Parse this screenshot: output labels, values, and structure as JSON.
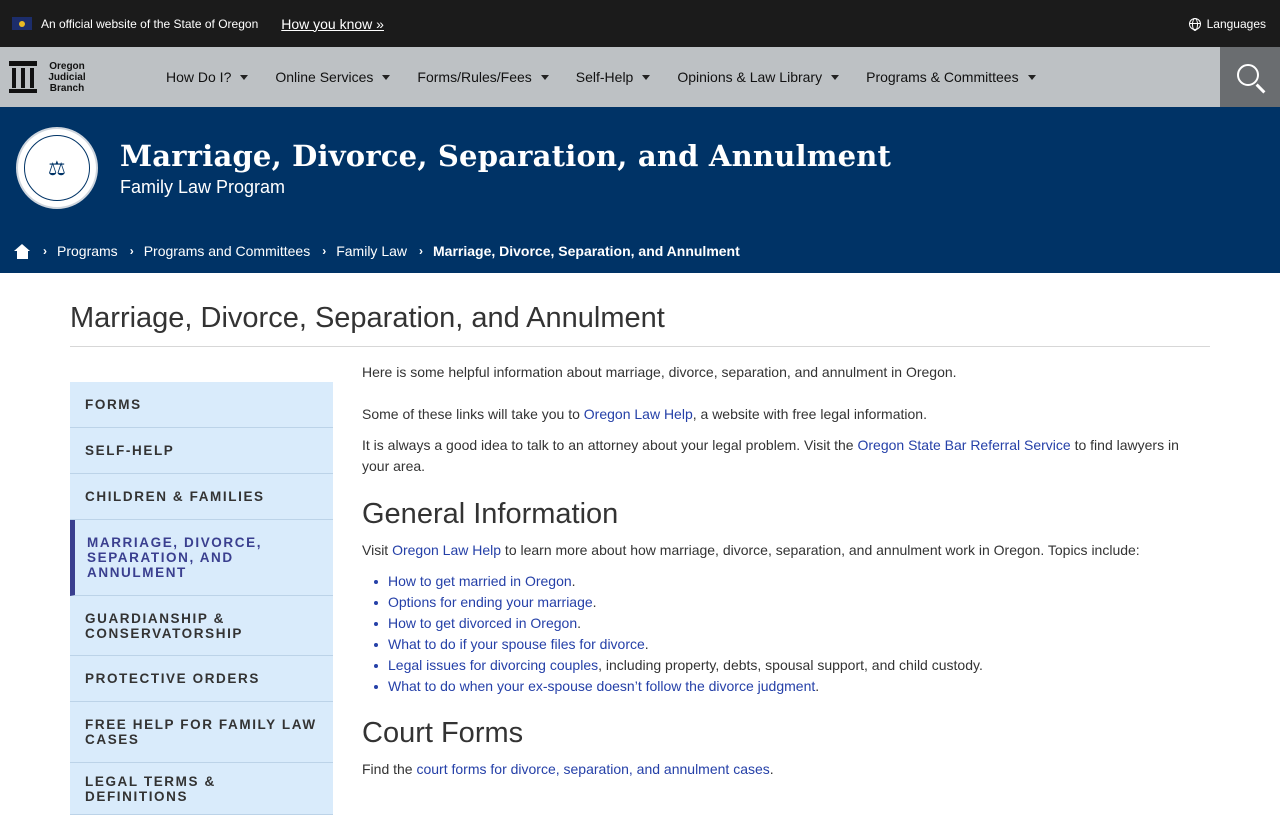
{
  "topbar": {
    "official_text": "An official website of the State of Oregon",
    "how_you_know": "How you know »",
    "languages": "Languages"
  },
  "navbar": {
    "logo_text": "Oregon Judicial Branch",
    "items": [
      {
        "label": "How Do I?"
      },
      {
        "label": "Online Services"
      },
      {
        "label": "Forms/Rules/Fees"
      },
      {
        "label": "Self-Help"
      },
      {
        "label": "Opinions & Law Library"
      },
      {
        "label": "Programs & Committees"
      }
    ]
  },
  "banner": {
    "title": "Marriage, Divorce, Separation, and Annulment",
    "subtitle": "Family Law Program",
    "breadcrumb": [
      {
        "label": "Programs"
      },
      {
        "label": "Programs and Committees"
      },
      {
        "label": "Family Law"
      },
      {
        "label": "Marriage, Divorce, Separation, and Annulment"
      }
    ]
  },
  "page": {
    "title": "Marriage, Divorce, Separation, and Annulment"
  },
  "sidenav": {
    "items": [
      {
        "label": "Forms"
      },
      {
        "label": "Self-Help"
      },
      {
        "label": "Children & Families"
      },
      {
        "label": "Marriage, Divorce, Separation, and Annulment"
      },
      {
        "label": "Guardianship & Conservatorship"
      },
      {
        "label": "Protective Orders"
      },
      {
        "label": "Free Help for Family Law Cases"
      },
      {
        "label": "Legal Terms & Definitions"
      }
    ]
  },
  "main": {
    "intro": "Here is some helpful information about marriage, divorce, separation, and annulment in Oregon.",
    "p2_before": "Some of these links will take you to ",
    "p2_link": "Oregon Law Help",
    "p2_after": ", a website with free legal information.",
    "p3_before": "It is always a good idea to talk to an attorney about your legal problem. Visit the ",
    "p3_link": "Oregon State Bar Referral Service",
    "p3_after": " to find lawyers in your area.",
    "general_heading": "General Information",
    "general_before": "Visit ",
    "general_link": "Oregon Law Help",
    "general_after": " to learn more about how marriage, divorce, separation, and annulment work in Oregon. Topics include:",
    "topics": [
      {
        "link": "How to get married in Oregon",
        "after": "."
      },
      {
        "link": "Options for ending your marriage",
        "after": "."
      },
      {
        "link": "How to get divorced in Oregon",
        "after": "."
      },
      {
        "link": "What to do if your spouse files for divorce",
        "after": "."
      },
      {
        "link": "Legal issues for divorcing couples",
        "after": ", including property, debts, spousal support, and child custody."
      },
      {
        "link": "What to do when your ex-spouse doesn’t follow the divorce judgment",
        "after": "."
      }
    ],
    "forms_heading": "Court Forms",
    "forms_before": "Find the ",
    "forms_link": "court forms for divorce, separation, and annulment cases",
    "forms_after": "."
  }
}
